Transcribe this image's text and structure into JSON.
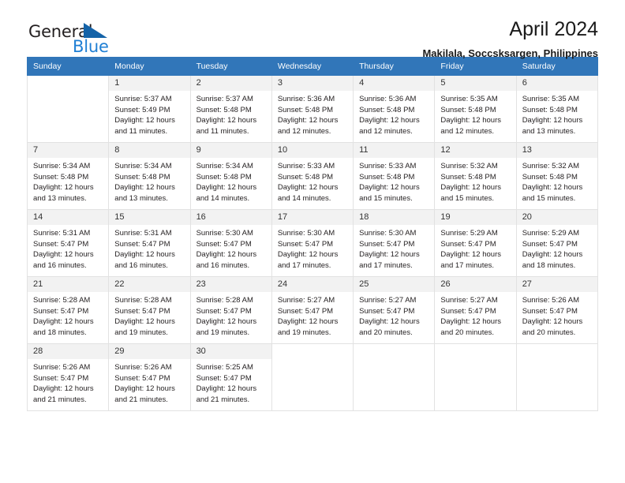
{
  "brand": {
    "name_part1": "General",
    "name_part2": "Blue",
    "triangle_icon": "triangle-icon",
    "colors": {
      "dark": "#231f20",
      "blue": "#1f7fd4",
      "triangle": "#1463a8"
    }
  },
  "header": {
    "title": "April 2024",
    "subtitle": "Makilala, Soccsksargen, Philippines"
  },
  "theme": {
    "header_bg": "#3176b9",
    "daynum_bg": "#f2f2f2",
    "cell_border": "#e2e2e2"
  },
  "weekdays": [
    "Sunday",
    "Monday",
    "Tuesday",
    "Wednesday",
    "Thursday",
    "Friday",
    "Saturday"
  ],
  "weeks": [
    [
      {
        "day": "",
        "sunrise": "",
        "sunset": "",
        "daylight": ""
      },
      {
        "day": "1",
        "sunrise": "Sunrise: 5:37 AM",
        "sunset": "Sunset: 5:49 PM",
        "daylight": "Daylight: 12 hours and 11 minutes."
      },
      {
        "day": "2",
        "sunrise": "Sunrise: 5:37 AM",
        "sunset": "Sunset: 5:48 PM",
        "daylight": "Daylight: 12 hours and 11 minutes."
      },
      {
        "day": "3",
        "sunrise": "Sunrise: 5:36 AM",
        "sunset": "Sunset: 5:48 PM",
        "daylight": "Daylight: 12 hours and 12 minutes."
      },
      {
        "day": "4",
        "sunrise": "Sunrise: 5:36 AM",
        "sunset": "Sunset: 5:48 PM",
        "daylight": "Daylight: 12 hours and 12 minutes."
      },
      {
        "day": "5",
        "sunrise": "Sunrise: 5:35 AM",
        "sunset": "Sunset: 5:48 PM",
        "daylight": "Daylight: 12 hours and 12 minutes."
      },
      {
        "day": "6",
        "sunrise": "Sunrise: 5:35 AM",
        "sunset": "Sunset: 5:48 PM",
        "daylight": "Daylight: 12 hours and 13 minutes."
      }
    ],
    [
      {
        "day": "7",
        "sunrise": "Sunrise: 5:34 AM",
        "sunset": "Sunset: 5:48 PM",
        "daylight": "Daylight: 12 hours and 13 minutes."
      },
      {
        "day": "8",
        "sunrise": "Sunrise: 5:34 AM",
        "sunset": "Sunset: 5:48 PM",
        "daylight": "Daylight: 12 hours and 13 minutes."
      },
      {
        "day": "9",
        "sunrise": "Sunrise: 5:34 AM",
        "sunset": "Sunset: 5:48 PM",
        "daylight": "Daylight: 12 hours and 14 minutes."
      },
      {
        "day": "10",
        "sunrise": "Sunrise: 5:33 AM",
        "sunset": "Sunset: 5:48 PM",
        "daylight": "Daylight: 12 hours and 14 minutes."
      },
      {
        "day": "11",
        "sunrise": "Sunrise: 5:33 AM",
        "sunset": "Sunset: 5:48 PM",
        "daylight": "Daylight: 12 hours and 15 minutes."
      },
      {
        "day": "12",
        "sunrise": "Sunrise: 5:32 AM",
        "sunset": "Sunset: 5:48 PM",
        "daylight": "Daylight: 12 hours and 15 minutes."
      },
      {
        "day": "13",
        "sunrise": "Sunrise: 5:32 AM",
        "sunset": "Sunset: 5:48 PM",
        "daylight": "Daylight: 12 hours and 15 minutes."
      }
    ],
    [
      {
        "day": "14",
        "sunrise": "Sunrise: 5:31 AM",
        "sunset": "Sunset: 5:47 PM",
        "daylight": "Daylight: 12 hours and 16 minutes."
      },
      {
        "day": "15",
        "sunrise": "Sunrise: 5:31 AM",
        "sunset": "Sunset: 5:47 PM",
        "daylight": "Daylight: 12 hours and 16 minutes."
      },
      {
        "day": "16",
        "sunrise": "Sunrise: 5:30 AM",
        "sunset": "Sunset: 5:47 PM",
        "daylight": "Daylight: 12 hours and 16 minutes."
      },
      {
        "day": "17",
        "sunrise": "Sunrise: 5:30 AM",
        "sunset": "Sunset: 5:47 PM",
        "daylight": "Daylight: 12 hours and 17 minutes."
      },
      {
        "day": "18",
        "sunrise": "Sunrise: 5:30 AM",
        "sunset": "Sunset: 5:47 PM",
        "daylight": "Daylight: 12 hours and 17 minutes."
      },
      {
        "day": "19",
        "sunrise": "Sunrise: 5:29 AM",
        "sunset": "Sunset: 5:47 PM",
        "daylight": "Daylight: 12 hours and 17 minutes."
      },
      {
        "day": "20",
        "sunrise": "Sunrise: 5:29 AM",
        "sunset": "Sunset: 5:47 PM",
        "daylight": "Daylight: 12 hours and 18 minutes."
      }
    ],
    [
      {
        "day": "21",
        "sunrise": "Sunrise: 5:28 AM",
        "sunset": "Sunset: 5:47 PM",
        "daylight": "Daylight: 12 hours and 18 minutes."
      },
      {
        "day": "22",
        "sunrise": "Sunrise: 5:28 AM",
        "sunset": "Sunset: 5:47 PM",
        "daylight": "Daylight: 12 hours and 19 minutes."
      },
      {
        "day": "23",
        "sunrise": "Sunrise: 5:28 AM",
        "sunset": "Sunset: 5:47 PM",
        "daylight": "Daylight: 12 hours and 19 minutes."
      },
      {
        "day": "24",
        "sunrise": "Sunrise: 5:27 AM",
        "sunset": "Sunset: 5:47 PM",
        "daylight": "Daylight: 12 hours and 19 minutes."
      },
      {
        "day": "25",
        "sunrise": "Sunrise: 5:27 AM",
        "sunset": "Sunset: 5:47 PM",
        "daylight": "Daylight: 12 hours and 20 minutes."
      },
      {
        "day": "26",
        "sunrise": "Sunrise: 5:27 AM",
        "sunset": "Sunset: 5:47 PM",
        "daylight": "Daylight: 12 hours and 20 minutes."
      },
      {
        "day": "27",
        "sunrise": "Sunrise: 5:26 AM",
        "sunset": "Sunset: 5:47 PM",
        "daylight": "Daylight: 12 hours and 20 minutes."
      }
    ],
    [
      {
        "day": "28",
        "sunrise": "Sunrise: 5:26 AM",
        "sunset": "Sunset: 5:47 PM",
        "daylight": "Daylight: 12 hours and 21 minutes."
      },
      {
        "day": "29",
        "sunrise": "Sunrise: 5:26 AM",
        "sunset": "Sunset: 5:47 PM",
        "daylight": "Daylight: 12 hours and 21 minutes."
      },
      {
        "day": "30",
        "sunrise": "Sunrise: 5:25 AM",
        "sunset": "Sunset: 5:47 PM",
        "daylight": "Daylight: 12 hours and 21 minutes."
      },
      {
        "day": "",
        "sunrise": "",
        "sunset": "",
        "daylight": ""
      },
      {
        "day": "",
        "sunrise": "",
        "sunset": "",
        "daylight": ""
      },
      {
        "day": "",
        "sunrise": "",
        "sunset": "",
        "daylight": ""
      },
      {
        "day": "",
        "sunrise": "",
        "sunset": "",
        "daylight": ""
      }
    ]
  ]
}
